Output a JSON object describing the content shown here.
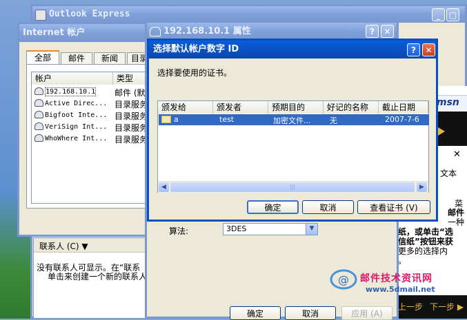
{
  "oe_window": {
    "title": "Outlook Express"
  },
  "accounts_window": {
    "title": "Internet 帐户",
    "tabs": [
      "全部",
      "邮件",
      "新闻",
      "目录"
    ],
    "columns": [
      "帐户",
      "类型"
    ],
    "rows": [
      {
        "name": "192.168.10.1",
        "type": "邮件 (默"
      },
      {
        "name": "Active Direc...",
        "type": "目录服务"
      },
      {
        "name": "Bigfoot Inte...",
        "type": "目录服务"
      },
      {
        "name": "VeriSign Int...",
        "type": "目录服务"
      },
      {
        "name": "WhoWhere Int...",
        "type": "目录服务"
      }
    ]
  },
  "contacts_pane": {
    "header": "联系人 (C) ▼",
    "line1": "没有联系人可显示。在“联系",
    "line2": "单击来创建一个新的联系人"
  },
  "props_window": {
    "title": "192.168.10.1 属性",
    "algorithm_label": "算法:",
    "algorithm_value": "3DES",
    "ok": "确定",
    "cancel": "取消",
    "apply": "应用 (A)"
  },
  "cert_dialog": {
    "title": "选择默认帐户数字 ID",
    "prompt": "选择要使用的证书。",
    "columns": [
      "颁发给",
      "颁发者",
      "预期目的",
      "好记的名称",
      "截止日期"
    ],
    "row": {
      "issued_to": "a",
      "issuer": "test",
      "purpose": "加密文件...",
      "friendly": "无",
      "expires": "2007-7-6"
    },
    "ok": "确定",
    "cancel": "取消",
    "view": "查看证书 (V)"
  },
  "right_panel": {
    "msn": "msn",
    "text_frag": "文本",
    "frag2": "菜",
    "frag3": "邮件",
    "frag4": "一种",
    "line1": "纸，或单击“选",
    "line2": "信纸”按钮来获",
    "line3": "更多的选择内",
    "line4": "。",
    "prev": "上一步",
    "next": "下一步 ▶"
  },
  "watermark": {
    "cn": "邮件技术资讯网",
    "url": "www.5dmail.net"
  }
}
